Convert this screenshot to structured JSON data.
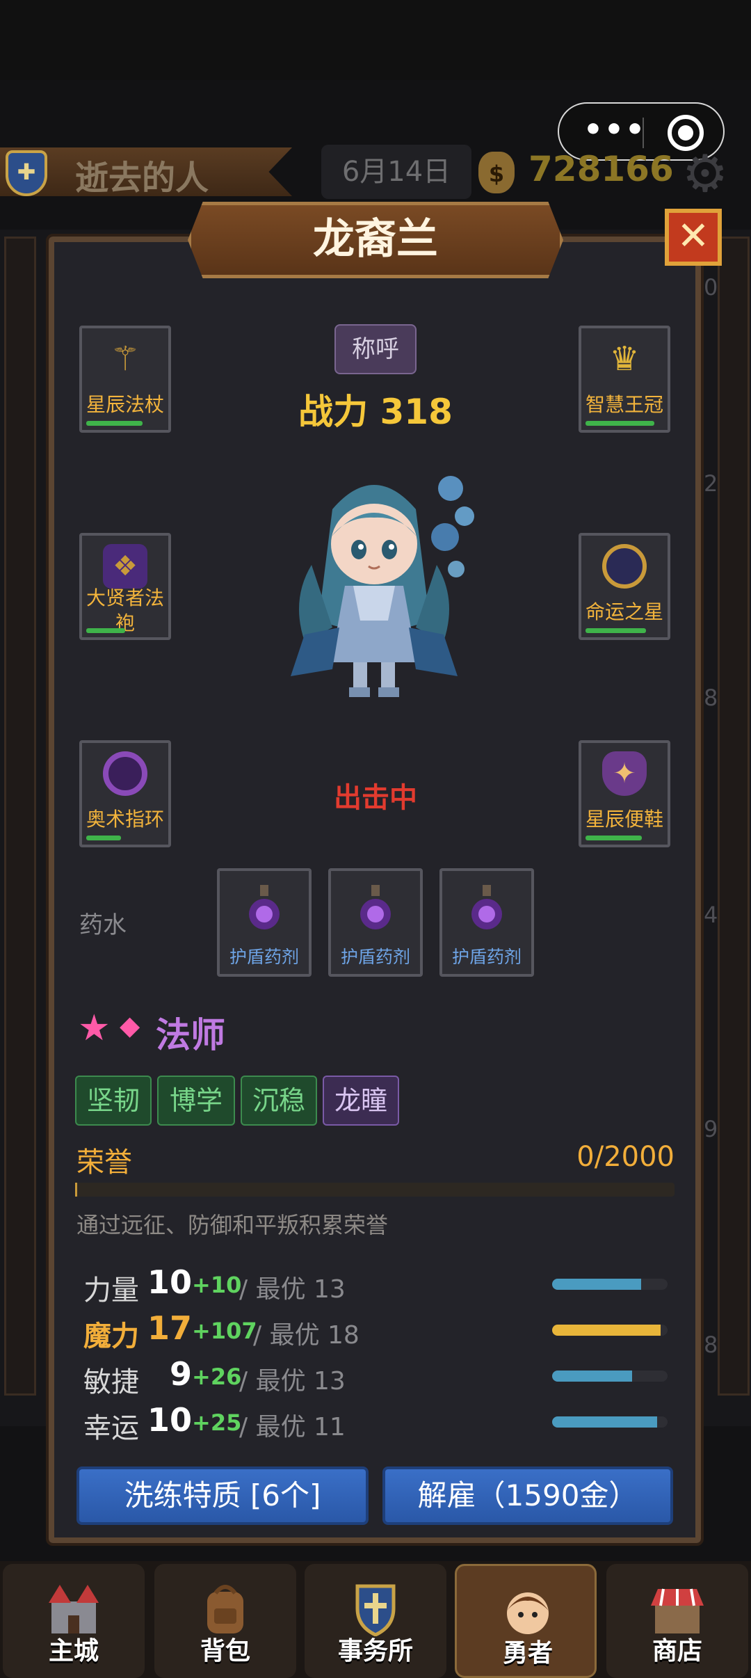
{
  "header": {
    "player_name": "逝去的人",
    "date": "6月14日",
    "gold": "728166",
    "mini_program_menu": "•••"
  },
  "dialog": {
    "title": "龙裔兰",
    "close_label": "✕",
    "title_button": "称呼",
    "power_label": "战力 318",
    "status": "出击中"
  },
  "equipment": {
    "weapon": "星辰法杖",
    "head": "智慧王冠",
    "body": "大贤者法袍",
    "amulet": "命运之星",
    "ring": "奥术指环",
    "feet": "星辰便鞋"
  },
  "durability": {
    "weapon": 0.72,
    "head": 0.88,
    "body": 0.5,
    "amulet": 0.78,
    "ring": 0.45,
    "feet": 0.72
  },
  "potions": {
    "label": "药水",
    "items": [
      "护盾药剂",
      "护盾药剂",
      "护盾药剂"
    ]
  },
  "hero_class": {
    "star": "★",
    "diamond": "◆",
    "name": "法师"
  },
  "traits": [
    "坚韧",
    "博学",
    "沉稳",
    "龙瞳"
  ],
  "honor": {
    "label": "荣誉",
    "value": "0/2000",
    "progress": 0,
    "description": "通过远征、防御和平叛积累荣誉"
  },
  "stats": [
    {
      "name": "力量",
      "value": "10",
      "bonus": "+10",
      "best": "/ 最优 13",
      "fill": 0.77,
      "color": "#4a9bc0"
    },
    {
      "name": "魔力",
      "value": "17",
      "bonus": "+107",
      "best": "/ 最优 18",
      "fill": 0.94,
      "color": "#e8b53a"
    },
    {
      "name": "敏捷",
      "value": "9",
      "bonus": "+26",
      "best": "/ 最优 13",
      "fill": 0.69,
      "color": "#4a9bc0"
    },
    {
      "name": "幸运",
      "value": "10",
      "bonus": "+25",
      "best": "/ 最优 11",
      "fill": 0.91,
      "color": "#4a9bc0"
    }
  ],
  "buttons": {
    "retrain": "洗练特质 [6个]",
    "dismiss": "解雇（1590金）"
  },
  "nav": [
    "主城",
    "背包",
    "事务所",
    "勇者",
    "商店"
  ],
  "colors": {
    "gold_text": "#f5c73a",
    "deploy_red": "#e23b2f",
    "mage_purple": "#c07ae2",
    "bonus_green": "#5fd35f",
    "button_blue": "#3a6fc7"
  }
}
